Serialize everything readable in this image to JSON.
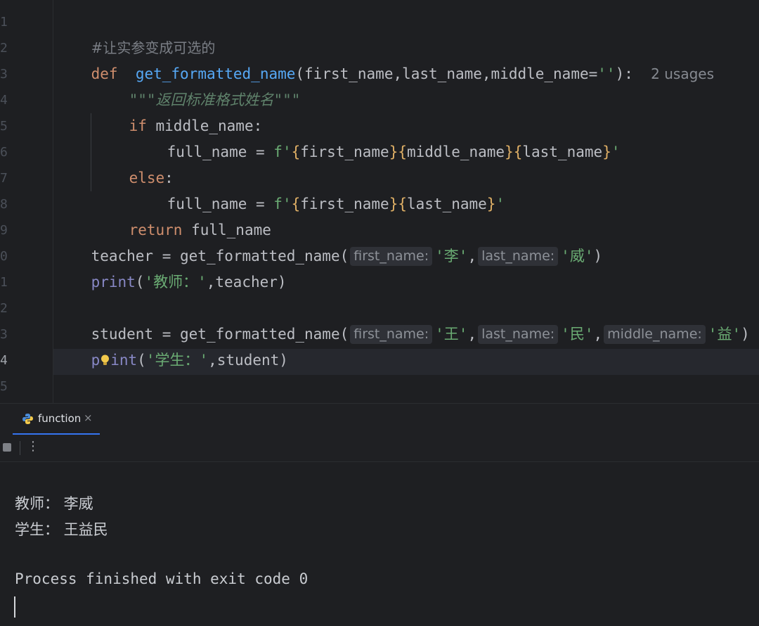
{
  "editor": {
    "line_numbers": [
      "1",
      "2",
      "3",
      "4",
      "5",
      "6",
      "7",
      "8",
      "9",
      "0",
      "1",
      "2",
      "3",
      "4",
      "5"
    ],
    "lines": {
      "l1": {
        "comment": "#让实参变成可选的"
      },
      "l2": {
        "kw": "def",
        "fn": "get_formatted_name",
        "params": "(first_name,last_name,middle_name=",
        "str": "''",
        "end": "):",
        "hint": "2 usages"
      },
      "l3": {
        "doc": "\"\"\"返回标准格式姓名\"\"\""
      },
      "l4": {
        "kw": "if",
        "rest": " middle_name:"
      },
      "l5": {
        "pre": "full_name = ",
        "fstr_open": "f'",
        "b1": "{",
        "v1": "first_name",
        "b2": "}",
        "b3": "{",
        "v2": "middle_name",
        "b4": "}",
        "b5": "{",
        "v3": "last_name",
        "b6": "}",
        "fstr_close": "'"
      },
      "l6": {
        "kw": "else",
        "rest": ":"
      },
      "l7": {
        "pre": "full_name = ",
        "fstr_open": "f'",
        "b1": "{",
        "v1": "first_name",
        "b2": "}",
        "b3": "{",
        "v2": "last_name",
        "b4": "}",
        "fstr_close": "'"
      },
      "l8": {
        "kw": "return",
        "rest": " full_name"
      },
      "l9": {
        "pre": "teacher = get_formatted_name(",
        "hint1": "first_name:",
        "s1": "'李'",
        "comma1": ",",
        "hint2": "last_name:",
        "s2": "'威'",
        "end": ")"
      },
      "l10": {
        "print": "print",
        "open": "(",
        "str": "'教师：'",
        "rest": ",teacher)"
      },
      "l12": {
        "pre": "student = get_formatted_name(",
        "hint1": "first_name:",
        "s1": "'王'",
        "comma1": ",",
        "hint2": "last_name:",
        "s2": "'民'",
        "comma2": ",",
        "hint3": "middle_name:",
        "s3": "'益'",
        "end": ")"
      },
      "l13": {
        "print_a": "p",
        "print_b": "int",
        "open": "(",
        "str": "'学生：'",
        "rest": ",student)"
      }
    }
  },
  "run_panel": {
    "tab_label": "function",
    "tab_close": "×",
    "more_label": "⋮"
  },
  "console": {
    "output": [
      "教师： 李威",
      "学生： 王益民",
      "",
      "Process finished with exit code 0"
    ]
  },
  "colors": {
    "keyword": "#cf8e6d",
    "function": "#56a8f5",
    "string": "#6aab73",
    "accent": "#3574f0"
  },
  "icons": {
    "tab": "python-icon",
    "toolbar": [
      "stop-icon",
      "more-options-icon"
    ],
    "editor": "intention-bulb-icon"
  }
}
